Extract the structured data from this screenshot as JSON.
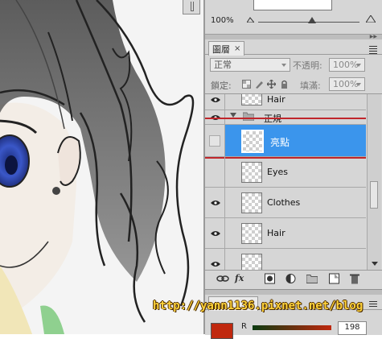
{
  "navigator": {
    "zoom": "100%"
  },
  "layers_panel": {
    "tab_label": "圖層",
    "close_glyph": "×",
    "blend_mode": "正常",
    "opacity_label": "不透明:",
    "opacity_value": "100%",
    "lock_label": "鎖定:",
    "fill_label": "填滿:",
    "fill_value": "100%",
    "layers": [
      {
        "name": "Hair",
        "visible": true
      },
      {
        "name": "正規",
        "visible": true,
        "type": "group"
      },
      {
        "name": "亮點",
        "visible": false,
        "selected": true
      },
      {
        "name": "Eyes",
        "visible": false
      },
      {
        "name": "Clothes",
        "visible": true
      },
      {
        "name": "Hair",
        "visible": true
      }
    ],
    "bottom_buttons": [
      "link-icon",
      "fx-icon",
      "mask-icon",
      "adjustment-icon",
      "group-icon",
      "new-layer-icon",
      "trash-icon"
    ],
    "fx_label": "fx"
  },
  "color_panel": {
    "channel_label": "R",
    "channel_value": "198",
    "foreground_color": "#c0280e"
  },
  "watermark": "http://yann1136.pixnet.net/blog",
  "colors": {
    "selection": "#3b95ec",
    "highlight_box": "#c0262b",
    "panel_bg": "#d6d6d6"
  }
}
